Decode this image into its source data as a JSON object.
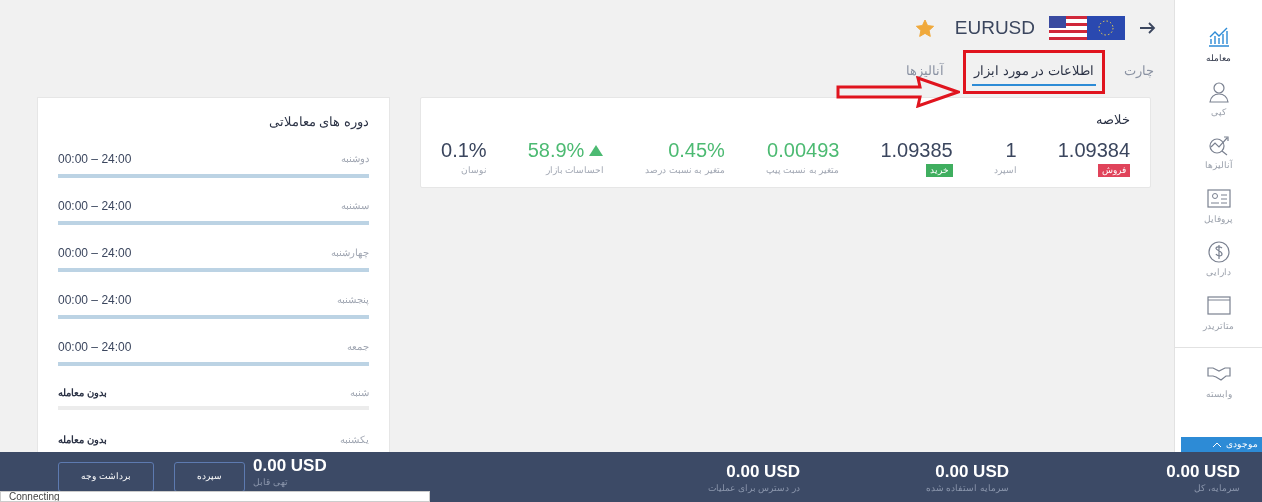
{
  "header": {
    "symbol": "EURUSD",
    "favorite": true
  },
  "tabs": [
    {
      "label": "چارت",
      "selected": false
    },
    {
      "label": "اطلاعات در مورد ابزار",
      "selected": true
    },
    {
      "label": "آنالیزها",
      "selected": false
    }
  ],
  "summary": {
    "title": "خلاصه",
    "items": [
      {
        "kind": "price",
        "value": "1.09384",
        "badge": "فروش",
        "color": "#e0435a"
      },
      {
        "kind": "stat",
        "value": "1",
        "label": "اسپرد"
      },
      {
        "kind": "price",
        "value": "1.09385",
        "badge": "خرید",
        "color": "#3fae5f"
      },
      {
        "kind": "change",
        "value": "0.00493",
        "label": "متغیر به نسبت پیپ"
      },
      {
        "kind": "change",
        "value": "0.45%",
        "label": "متغیر به نسبت درصد"
      },
      {
        "kind": "sentiment",
        "value": "58.9%",
        "label": "احساسات بازار"
      },
      {
        "kind": "stat",
        "value": "0.1%",
        "label": "نوسان"
      }
    ]
  },
  "schedule": {
    "title": "دوره های معاملاتی",
    "days": [
      {
        "day": "دوشنبه",
        "kind": "open",
        "hours": "24:00 – 00:00"
      },
      {
        "day": "سشنبه",
        "kind": "open",
        "hours": "24:00 – 00:00"
      },
      {
        "day": "چهارشنبه",
        "kind": "open",
        "hours": "24:00 – 00:00"
      },
      {
        "day": "پنجشنبه",
        "kind": "open",
        "hours": "24:00 – 00:00"
      },
      {
        "day": "جمعه",
        "kind": "open",
        "hours": "24:00 – 00:00"
      },
      {
        "day": "شنبه",
        "kind": "closed",
        "hours": "بدون معامله"
      },
      {
        "day": "یکشنبه",
        "kind": "closed",
        "hours": "بدون معامله"
      }
    ]
  },
  "sidebar": {
    "items": [
      {
        "kind": "chart",
        "label": "معامله",
        "selected": true
      },
      {
        "kind": "person",
        "label": "کپی",
        "selected": false
      },
      {
        "kind": "analysis",
        "label": "آنالیزها",
        "selected": false
      },
      {
        "kind": "profile",
        "label": "پروفایل",
        "selected": false
      },
      {
        "kind": "dollar",
        "label": "دارایی",
        "selected": false
      },
      {
        "kind": "window",
        "label": "متاتریدر",
        "selected": false
      },
      {
        "kind": "handshake",
        "label": "وابسته",
        "selected": false
      }
    ],
    "balance_toggle": "موجودی"
  },
  "status_bar": {
    "stats": [
      {
        "value": "0.00 USD",
        "label": "سرمایه، کل"
      },
      {
        "value": "0.00 USD",
        "label": "سرمایه استفاده شده"
      },
      {
        "value": "0.00 USD",
        "label": "در دسترس برای عملیات"
      },
      {
        "value": "0.00 USD",
        "label": "تهی قابل"
      }
    ],
    "buttons": [
      "سپرده",
      "برداشت وجه"
    ]
  },
  "connection": "Connecting"
}
